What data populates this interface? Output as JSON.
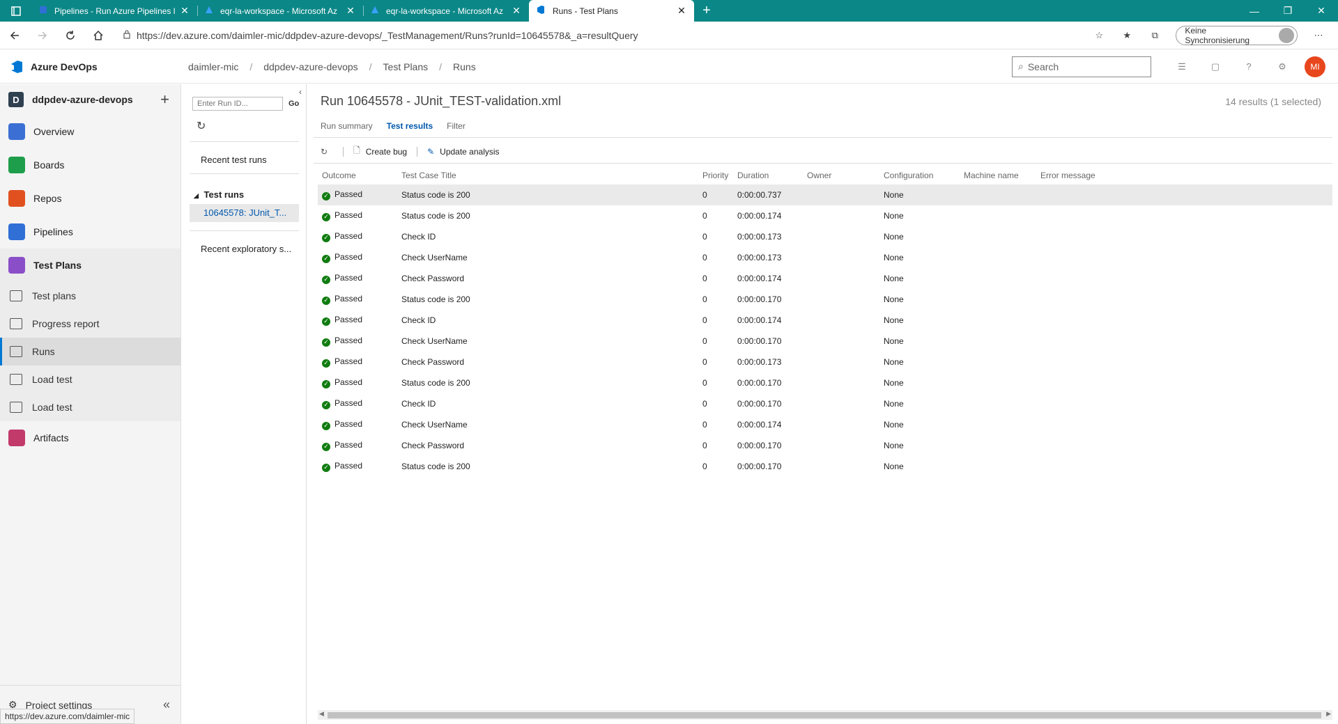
{
  "browser": {
    "tabs": [
      {
        "title": "Pipelines - Run Azure Pipelines l",
        "active": false
      },
      {
        "title": "eqr-la-workspace - Microsoft Az",
        "active": false
      },
      {
        "title": "eqr-la-workspace - Microsoft Az",
        "active": false
      },
      {
        "title": "Runs - Test Plans",
        "active": true
      }
    ],
    "url": "https://dev.azure.com/daimler-mic/ddpdev-azure-devops/_TestManagement/Runs?runId=10645578&_a=resultQuery",
    "sync_label": "Keine Synchronisierung",
    "status_url": "https://dev.azure.com/daimler-mic"
  },
  "header": {
    "brand": "Azure DevOps",
    "breadcrumb": [
      "daimler-mic",
      "ddpdev-azure-devops",
      "Test Plans",
      "Runs"
    ],
    "search_placeholder": "Search",
    "avatar_initials": "MI"
  },
  "leftnav": {
    "project_initial": "D",
    "project_name": "ddpdev-azure-devops",
    "items": [
      {
        "label": "Overview",
        "color": "#3b6fd4"
      },
      {
        "label": "Boards",
        "color": "#1e9e4a"
      },
      {
        "label": "Repos",
        "color": "#e0511f"
      },
      {
        "label": "Pipelines",
        "color": "#2f6fd6"
      },
      {
        "label": "Test Plans",
        "color": "#8a4fc8"
      }
    ],
    "subitems": [
      {
        "label": "Test plans"
      },
      {
        "label": "Progress report"
      },
      {
        "label": "Runs"
      },
      {
        "label": "Load test"
      },
      {
        "label": "Load test"
      }
    ],
    "artifacts_label": "Artifacts",
    "artifacts_color": "#c23a6a",
    "project_settings": "Project settings"
  },
  "runpane": {
    "runid_placeholder": "Enter Run ID...",
    "go_label": "Go",
    "recent_runs": "Recent test runs",
    "group_label": "Test runs",
    "selected_run": "10645578: JUnit_T...",
    "recent_exploratory": "Recent exploratory s..."
  },
  "main": {
    "title": "Run 10645578 - JUnit_TEST-validation.xml",
    "result_count": "14 results (1 selected)",
    "tabs": [
      "Run summary",
      "Test results",
      "Filter"
    ],
    "toolbar": {
      "create_bug": "Create bug",
      "update_analysis": "Update analysis"
    },
    "columns": [
      "Outcome",
      "Test Case Title",
      "Priority",
      "Duration",
      "Owner",
      "Configuration",
      "Machine name",
      "Error message"
    ],
    "rows": [
      {
        "outcome": "Passed",
        "title": "Status code is 200",
        "priority": "0",
        "duration": "0:00:00.737",
        "owner": "",
        "config": "None",
        "machine": "",
        "error": ""
      },
      {
        "outcome": "Passed",
        "title": "Status code is 200",
        "priority": "0",
        "duration": "0:00:00.174",
        "owner": "",
        "config": "None",
        "machine": "",
        "error": ""
      },
      {
        "outcome": "Passed",
        "title": "Check ID",
        "priority": "0",
        "duration": "0:00:00.173",
        "owner": "",
        "config": "None",
        "machine": "",
        "error": ""
      },
      {
        "outcome": "Passed",
        "title": "Check UserName",
        "priority": "0",
        "duration": "0:00:00.173",
        "owner": "",
        "config": "None",
        "machine": "",
        "error": ""
      },
      {
        "outcome": "Passed",
        "title": "Check Password",
        "priority": "0",
        "duration": "0:00:00.174",
        "owner": "",
        "config": "None",
        "machine": "",
        "error": ""
      },
      {
        "outcome": "Passed",
        "title": "Status code is 200",
        "priority": "0",
        "duration": "0:00:00.170",
        "owner": "",
        "config": "None",
        "machine": "",
        "error": ""
      },
      {
        "outcome": "Passed",
        "title": "Check ID",
        "priority": "0",
        "duration": "0:00:00.174",
        "owner": "",
        "config": "None",
        "machine": "",
        "error": ""
      },
      {
        "outcome": "Passed",
        "title": "Check UserName",
        "priority": "0",
        "duration": "0:00:00.170",
        "owner": "",
        "config": "None",
        "machine": "",
        "error": ""
      },
      {
        "outcome": "Passed",
        "title": "Check Password",
        "priority": "0",
        "duration": "0:00:00.173",
        "owner": "",
        "config": "None",
        "machine": "",
        "error": ""
      },
      {
        "outcome": "Passed",
        "title": "Status code is 200",
        "priority": "0",
        "duration": "0:00:00.170",
        "owner": "",
        "config": "None",
        "machine": "",
        "error": ""
      },
      {
        "outcome": "Passed",
        "title": "Check ID",
        "priority": "0",
        "duration": "0:00:00.170",
        "owner": "",
        "config": "None",
        "machine": "",
        "error": ""
      },
      {
        "outcome": "Passed",
        "title": "Check UserName",
        "priority": "0",
        "duration": "0:00:00.174",
        "owner": "",
        "config": "None",
        "machine": "",
        "error": ""
      },
      {
        "outcome": "Passed",
        "title": "Check Password",
        "priority": "0",
        "duration": "0:00:00.170",
        "owner": "",
        "config": "None",
        "machine": "",
        "error": ""
      },
      {
        "outcome": "Passed",
        "title": "Status code is 200",
        "priority": "0",
        "duration": "0:00:00.170",
        "owner": "",
        "config": "None",
        "machine": "",
        "error": ""
      }
    ]
  }
}
